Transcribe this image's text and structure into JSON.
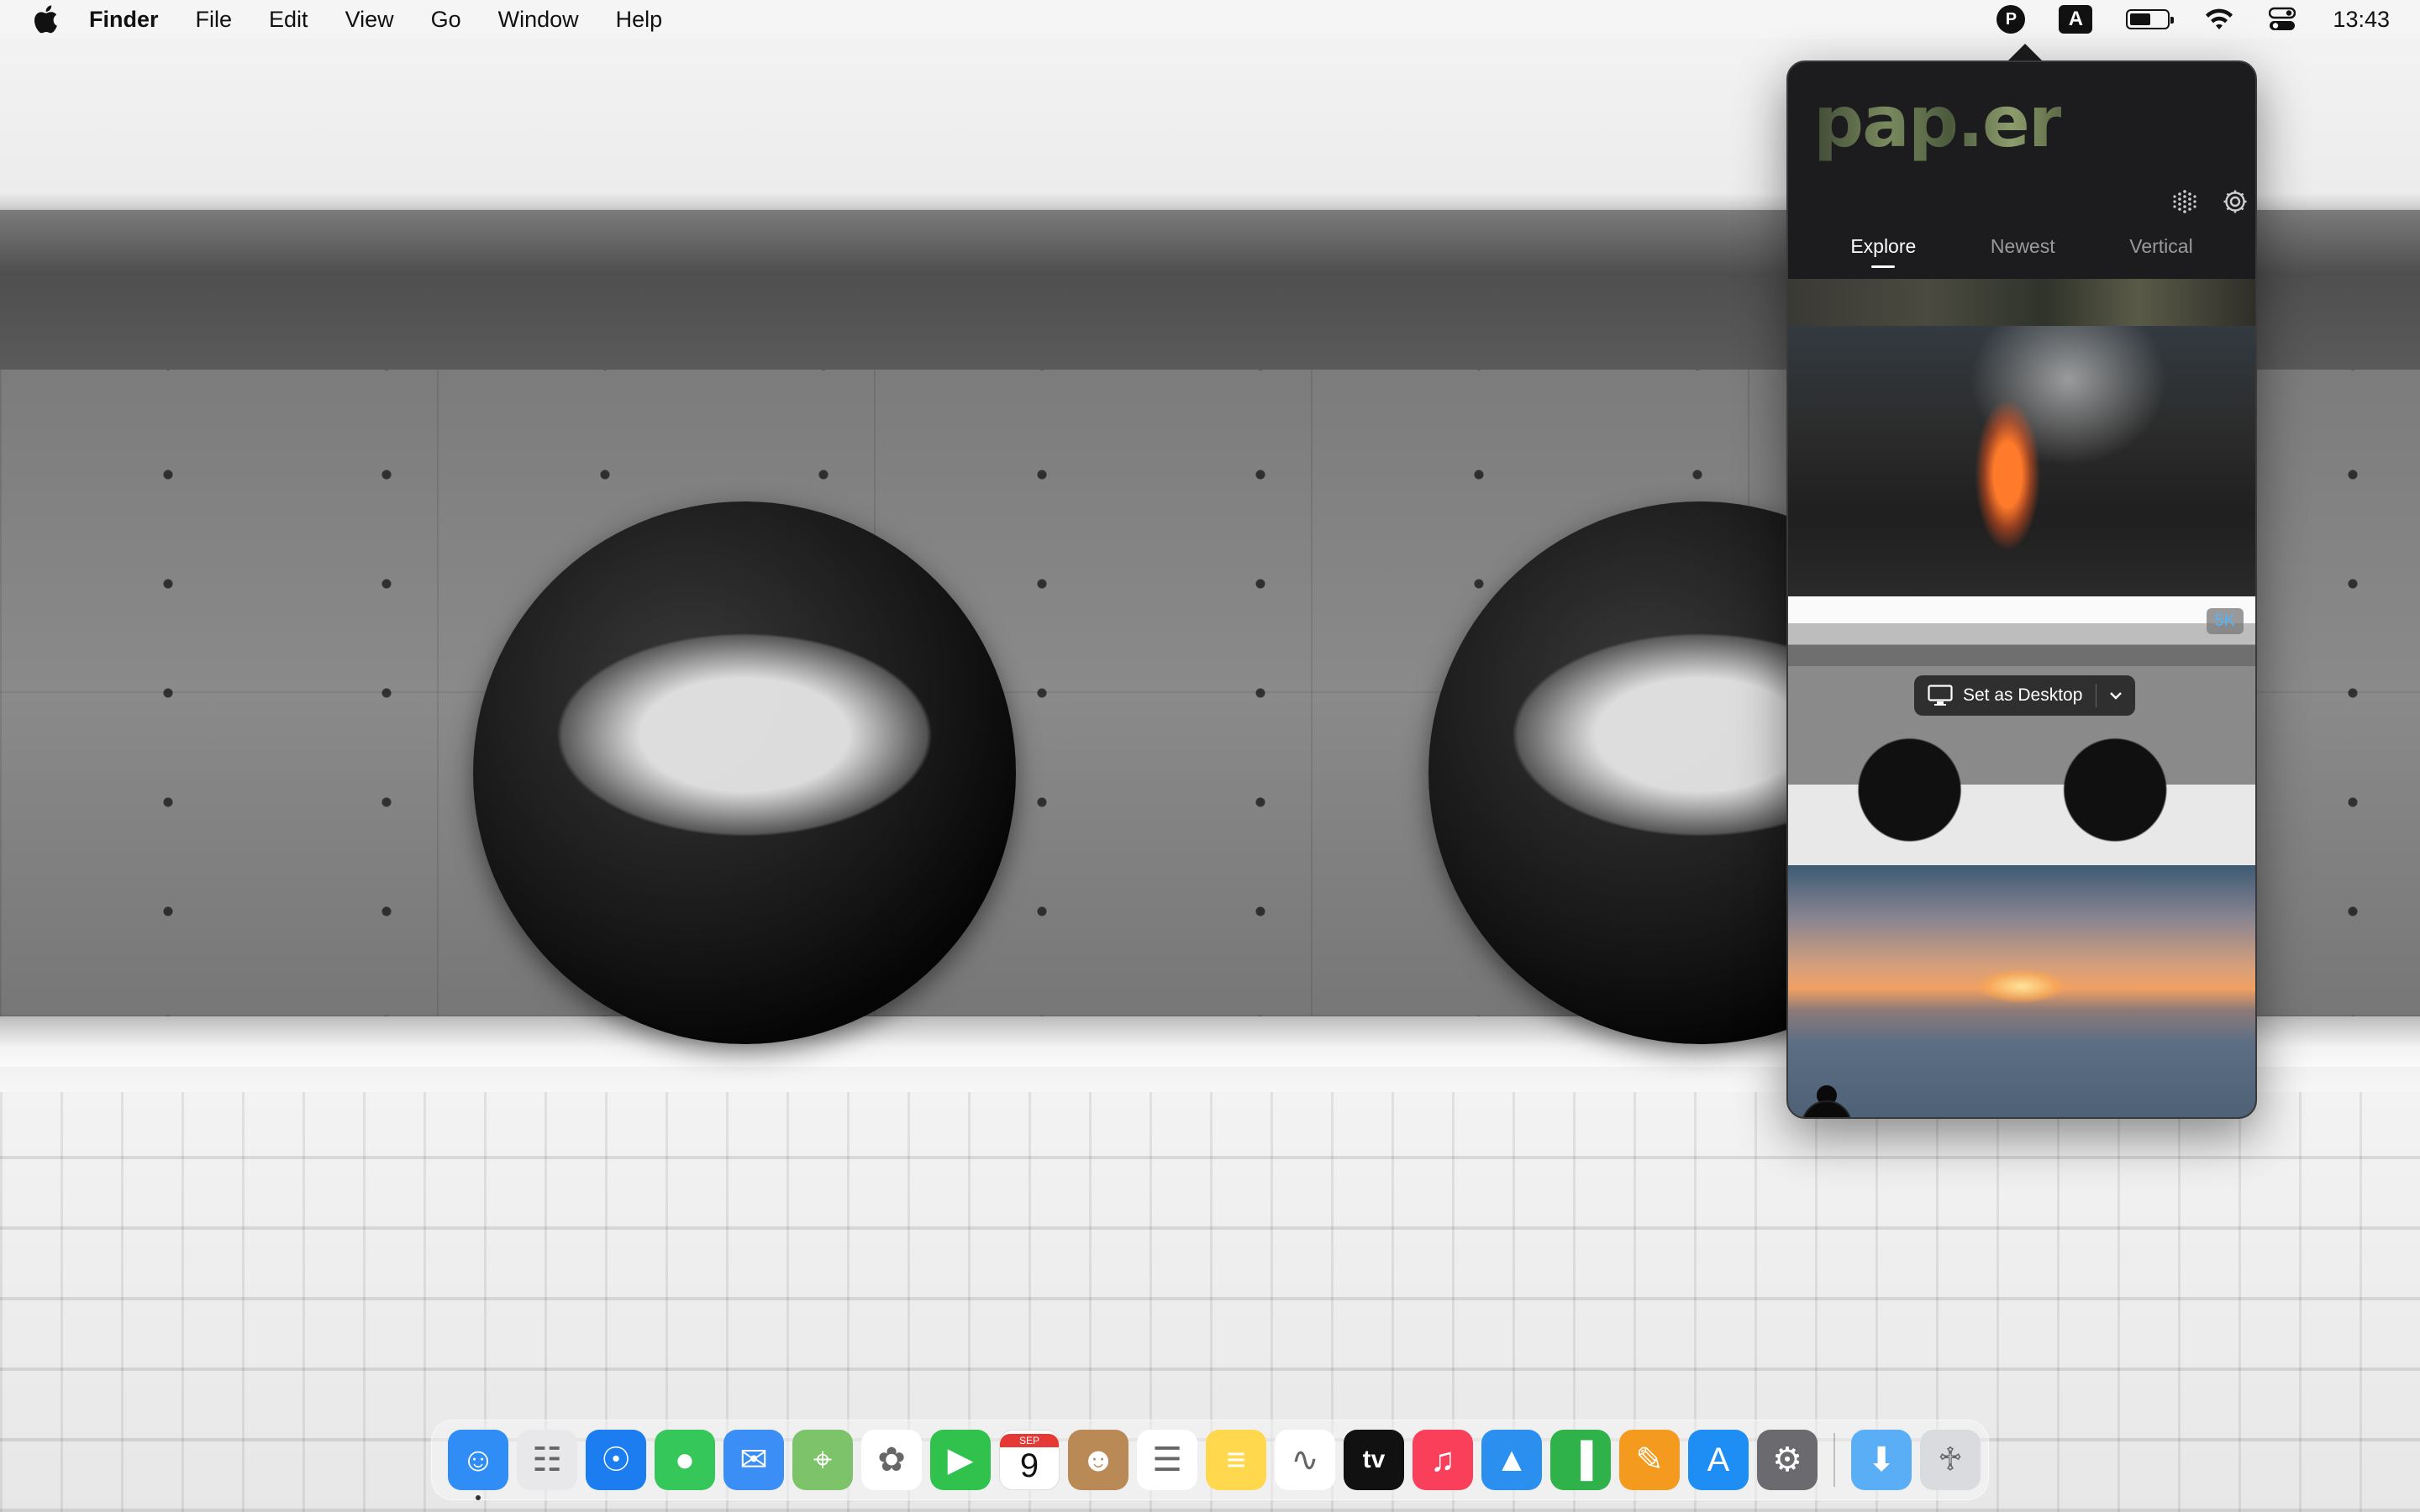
{
  "menubar": {
    "app_name": "Finder",
    "menus": [
      "File",
      "Edit",
      "View",
      "Go",
      "Window",
      "Help"
    ],
    "status": {
      "paper_initial": "P",
      "input_source": "A",
      "battery_level": 0.55,
      "clock": "13:43"
    }
  },
  "popover": {
    "logo_text": "pap.er",
    "tabs": [
      {
        "label": "Explore",
        "active": true
      },
      {
        "label": "Newest",
        "active": false
      },
      {
        "label": "Vertical",
        "active": false
      }
    ],
    "feed": {
      "hover_badge": "5K",
      "set_desktop_label": "Set as Desktop"
    }
  },
  "dock": {
    "items": [
      {
        "name": "finder",
        "icon": "finder-icon",
        "color": "#2f8df5",
        "running": true
      },
      {
        "name": "launchpad",
        "icon": "launchpad-icon",
        "color": "#e8e8ea",
        "running": false
      },
      {
        "name": "safari",
        "icon": "safari-icon",
        "color": "#1b7df0",
        "running": false
      },
      {
        "name": "messages",
        "icon": "messages-icon",
        "color": "#35c759",
        "running": false
      },
      {
        "name": "mail",
        "icon": "mail-icon",
        "color": "#3b8ef5",
        "running": false
      },
      {
        "name": "maps",
        "icon": "maps-icon",
        "color": "#7cc36a",
        "running": false
      },
      {
        "name": "photos",
        "icon": "photos-icon",
        "color": "#ffffff",
        "running": false
      },
      {
        "name": "facetime",
        "icon": "facetime-icon",
        "color": "#30c24d",
        "running": false
      },
      {
        "name": "calendar",
        "icon": "calendar-icon",
        "color": "#ffffff",
        "running": false,
        "month": "SEP",
        "day": "9"
      },
      {
        "name": "contacts",
        "icon": "contacts-icon",
        "color": "#b98a55",
        "running": false
      },
      {
        "name": "reminders",
        "icon": "reminders-icon",
        "color": "#ffffff",
        "running": false
      },
      {
        "name": "notes",
        "icon": "notes-icon",
        "color": "#ffd84d",
        "running": false
      },
      {
        "name": "freeform",
        "icon": "freeform-icon",
        "color": "#ffffff",
        "running": false
      },
      {
        "name": "tv",
        "icon": "apple-tv-icon",
        "color": "#111111",
        "running": false,
        "label": "tv"
      },
      {
        "name": "music",
        "icon": "music-icon",
        "color": "#fa3f5a",
        "running": false
      },
      {
        "name": "keynote",
        "icon": "keynote-icon",
        "color": "#2b8ff0",
        "running": false
      },
      {
        "name": "numbers",
        "icon": "numbers-icon",
        "color": "#2fb24a",
        "running": false
      },
      {
        "name": "pages",
        "icon": "pages-icon",
        "color": "#f49a1e",
        "running": false
      },
      {
        "name": "app-store",
        "icon": "app-store-icon",
        "color": "#1e8ef5",
        "running": false
      },
      {
        "name": "system-settings",
        "icon": "system-settings-icon",
        "color": "#6b6b6f",
        "running": false
      }
    ],
    "trailing": [
      {
        "name": "downloads",
        "icon": "downloads-folder-icon",
        "color": "#5aaef5"
      },
      {
        "name": "trash",
        "icon": "trash-icon",
        "color": "#d9dbdf"
      }
    ]
  }
}
